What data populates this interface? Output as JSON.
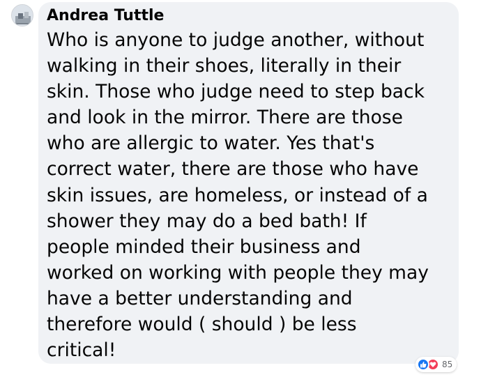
{
  "comment": {
    "author": "Andrea Tuttle",
    "text_lines": [
      "Who is anyone to judge another, without",
      "walking in their shoes, literally in their",
      "skin. Those who judge need to step back",
      "and look in the mirror. There are those",
      "who are allergic to water. Yes that's",
      "correct water, there are those who have",
      "skin issues, are homeless, or instead of a",
      "shower they may do a bed bath! If",
      "people minded their business and",
      "worked on working with people they may",
      "have a better understanding and",
      "therefore would ( should ) be less",
      "critical!"
    ]
  },
  "reactions": {
    "icons": [
      "like-icon",
      "love-icon"
    ],
    "count": "85"
  },
  "colors": {
    "bubble": "#f0f2f5",
    "text": "#050505",
    "like": "#1877f2",
    "love": "#f33e58",
    "count": "#65676b"
  }
}
